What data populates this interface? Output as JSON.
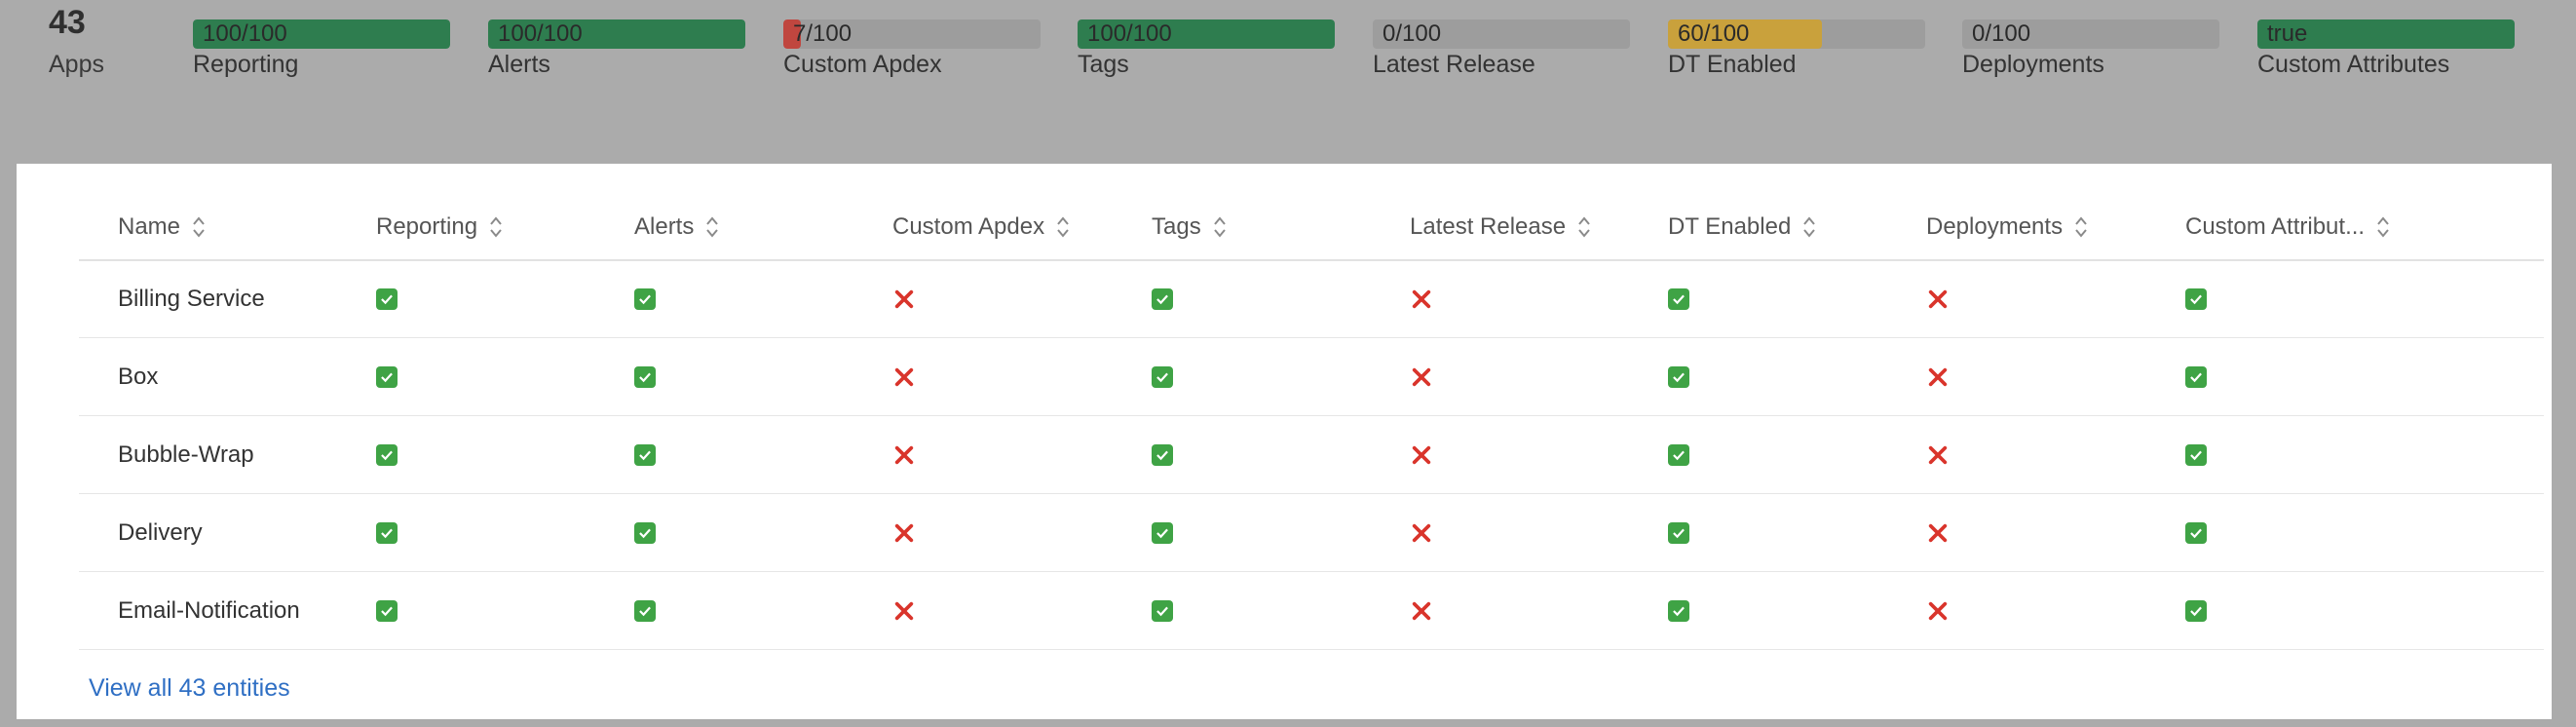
{
  "summary": {
    "apps_count": "43",
    "apps_label": "Apps",
    "metrics": [
      {
        "label": "Reporting",
        "value_text": "100/100",
        "level": 1.0,
        "color": "#2e7d4f"
      },
      {
        "label": "Alerts",
        "value_text": "100/100",
        "level": 1.0,
        "color": "#2e7d4f"
      },
      {
        "label": "Custom Apdex",
        "value_text": "7/100",
        "level": 0.07,
        "color": "#c0463f"
      },
      {
        "label": "Tags",
        "value_text": "100/100",
        "level": 1.0,
        "color": "#2e7d4f"
      },
      {
        "label": "Latest Release",
        "value_text": "0/100",
        "level": 0.0,
        "color": "#2e7d4f"
      },
      {
        "label": "DT Enabled",
        "value_text": "60/100",
        "level": 0.6,
        "color": "#c9a13c"
      },
      {
        "label": "Deployments",
        "value_text": "0/100",
        "level": 0.0,
        "color": "#2e7d4f"
      },
      {
        "label": "Custom Attributes",
        "value_text": "true",
        "level": 1.0,
        "color": "#2e7d4f"
      }
    ]
  },
  "table": {
    "columns": [
      "Name",
      "Reporting",
      "Alerts",
      "Custom Apdex",
      "Tags",
      "Latest Release",
      "DT Enabled",
      "Deployments",
      "Custom Attribut..."
    ],
    "rows": [
      {
        "name": "Billing Service",
        "checks": [
          true,
          true,
          false,
          true,
          false,
          true,
          false,
          true
        ]
      },
      {
        "name": "Box",
        "checks": [
          true,
          true,
          false,
          true,
          false,
          true,
          false,
          true
        ]
      },
      {
        "name": "Bubble-Wrap",
        "checks": [
          true,
          true,
          false,
          true,
          false,
          true,
          false,
          true
        ]
      },
      {
        "name": "Delivery",
        "checks": [
          true,
          true,
          false,
          true,
          false,
          true,
          false,
          true
        ]
      },
      {
        "name": "Email-Notification",
        "checks": [
          true,
          true,
          false,
          true,
          false,
          true,
          false,
          true
        ]
      }
    ],
    "view_all_label": "View all 43 entities"
  },
  "colors": {
    "check": "#3fa345",
    "cross": "#d9342b",
    "link": "#2f6fc4"
  }
}
